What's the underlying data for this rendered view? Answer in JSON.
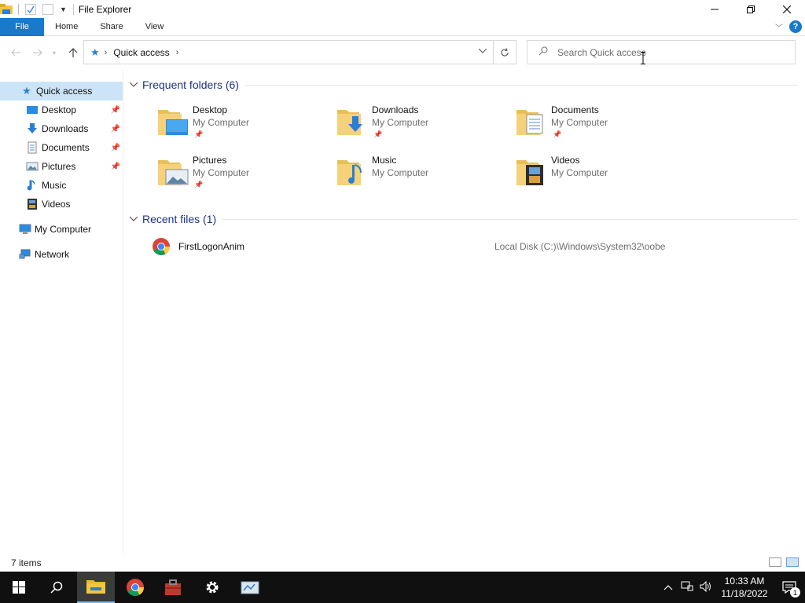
{
  "window": {
    "title": "File Explorer"
  },
  "ribbon": {
    "tabs": [
      "File",
      "Home",
      "Share",
      "View"
    ],
    "help": "?"
  },
  "address": {
    "location": "Quick access",
    "search_placeholder": "Search Quick access"
  },
  "nav": {
    "quick_access": "Quick access",
    "items": [
      {
        "label": "Desktop",
        "icon": "desktop-icon",
        "pinned": true
      },
      {
        "label": "Downloads",
        "icon": "downloads-icon",
        "pinned": true
      },
      {
        "label": "Documents",
        "icon": "documents-icon",
        "pinned": true
      },
      {
        "label": "Pictures",
        "icon": "pictures-icon",
        "pinned": true
      },
      {
        "label": "Music",
        "icon": "music-icon",
        "pinned": false
      },
      {
        "label": "Videos",
        "icon": "videos-icon",
        "pinned": false
      }
    ],
    "my_computer": "My Computer",
    "network": "Network"
  },
  "frequent": {
    "header": "Frequent folders (6)",
    "folders": [
      {
        "name": "Desktop",
        "location": "My Computer",
        "pinned": true
      },
      {
        "name": "Downloads",
        "location": "My Computer",
        "pinned": true
      },
      {
        "name": "Documents",
        "location": "My Computer",
        "pinned": true
      },
      {
        "name": "Pictures",
        "location": "My Computer",
        "pinned": true
      },
      {
        "name": "Music",
        "location": "My Computer",
        "pinned": false
      },
      {
        "name": "Videos",
        "location": "My Computer",
        "pinned": false
      }
    ]
  },
  "recent": {
    "header": "Recent files (1)",
    "files": [
      {
        "name": "FirstLogonAnim",
        "path": "Local Disk (C:)\\Windows\\System32\\oobe",
        "icon": "chrome-icon"
      }
    ]
  },
  "status": {
    "items": "7 items"
  },
  "taskbar": {
    "time": "10:33 AM",
    "date": "11/18/2022",
    "notification_count": "1"
  },
  "colors": {
    "accent": "#1979ca",
    "selection": "#cce4f7",
    "section_title": "#1e3287",
    "taskbar": "#101010"
  }
}
